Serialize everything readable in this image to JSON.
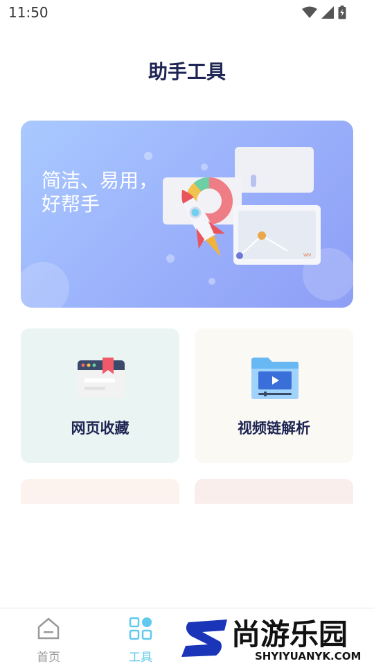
{
  "status_bar": {
    "time": "11:50"
  },
  "header": {
    "title": "助手工具"
  },
  "banner": {
    "line1": "简洁、易用，",
    "line2": "好帮手"
  },
  "tools": [
    {
      "label": "网页收藏",
      "bg": "#eaf5f3"
    },
    {
      "label": "视频链解析",
      "bg": "#fbf9f4"
    }
  ],
  "partial_cards": [
    {
      "bg": "#fcf3ee"
    },
    {
      "bg": "#faeeed"
    }
  ],
  "tabbar": {
    "tabs": [
      {
        "label": "首页",
        "icon": "home-icon",
        "active": false
      },
      {
        "label": "工具",
        "icon": "grid-icon",
        "active": true
      }
    ],
    "active_color": "#5fc9ee",
    "inactive_color": "#999999"
  },
  "watermark": {
    "brand": "尚游乐园",
    "url": "SHYIYUANYK.COM"
  }
}
